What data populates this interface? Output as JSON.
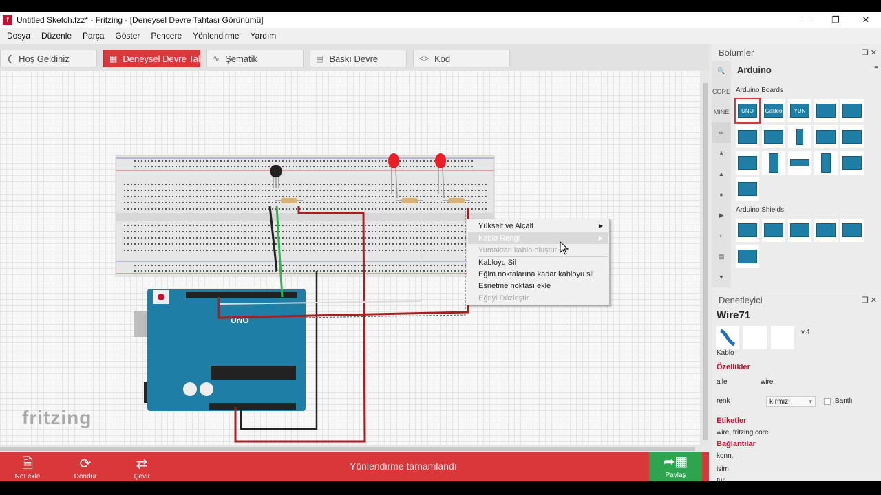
{
  "window": {
    "title": "Untitled Sketch.fzz* - Fritzing - [Deneysel Devre Tahtası Görünümü]",
    "icon_letter": "f"
  },
  "menu": [
    "Dosya",
    "Düzenle",
    "Parça",
    "Göster",
    "Pencere",
    "Yönlendirme",
    "Yardım"
  ],
  "tabs": [
    {
      "label": "Hoş Geldiniz",
      "icon": "back-icon"
    },
    {
      "label": "Deneysel Devre Tahtası",
      "icon": "breadboard-icon"
    },
    {
      "label": "Şematik",
      "icon": "schematic-icon"
    },
    {
      "label": "Baskı Devre",
      "icon": "pcb-icon"
    },
    {
      "label": "Kod",
      "icon": "code-icon"
    }
  ],
  "canvas": {
    "logo": "fritzing"
  },
  "context_menu": {
    "items": [
      {
        "label": "Yükselt ve Alçalt",
        "submenu": true,
        "disabled": false,
        "highlighted": false
      },
      {
        "label": "Kablo Rengi",
        "submenu": true,
        "disabled": false,
        "highlighted": true
      },
      {
        "label": "Yumaktan kablo oluştur",
        "submenu": false,
        "disabled": true,
        "highlighted": false
      },
      {
        "label": "Kabloyu Sil",
        "submenu": false,
        "disabled": false,
        "highlighted": false
      },
      {
        "label": "Eğim noktalarına kadar kabloyu sil",
        "submenu": false,
        "disabled": false,
        "highlighted": false
      },
      {
        "label": "Esnetme noktası ekle",
        "submenu": false,
        "disabled": false,
        "highlighted": false
      },
      {
        "label": "Eğriyi Düzleştir",
        "submenu": false,
        "disabled": true,
        "highlighted": false
      }
    ]
  },
  "bottom_bar": {
    "buttons": [
      {
        "label": "Not ekle",
        "icon": "note-icon"
      },
      {
        "label": "Döndür",
        "icon": "rotate-icon"
      },
      {
        "label": "Çevir",
        "icon": "flip-icon"
      }
    ],
    "status": "Yönlendirme tamamlandı",
    "share_label": "Paylaş"
  },
  "parts_bin": {
    "header": "Bölümler",
    "search_title": "Arduino",
    "side_tabs": [
      "CORE",
      "MINE"
    ],
    "sections": [
      {
        "title": "Arduino Boards",
        "items": [
          "UNO",
          "Galileo",
          "YUN",
          "",
          "",
          "",
          "",
          "",
          "",
          "",
          "",
          "",
          "",
          "",
          "",
          ""
        ]
      },
      {
        "title": "Arduino Shields",
        "items": [
          "",
          "",
          "",
          "",
          "",
          ""
        ]
      }
    ]
  },
  "inspector": {
    "header": "Denetleyici",
    "title": "Wire71",
    "version": "v.4",
    "kind": "Kablo",
    "properties_title": "Özellikler",
    "properties": [
      {
        "key": "aile",
        "value": "wire"
      },
      {
        "key": "renk",
        "value": "kırmızı",
        "checkbox_label": "Bantlı"
      }
    ],
    "tags_title": "Etiketler",
    "tags": "wire, fritzing core",
    "connections_title": "Bağlantılar",
    "connections": [
      {
        "key": "konn."
      },
      {
        "key": "isim"
      },
      {
        "key": "tür"
      }
    ]
  },
  "colors": {
    "accent": "#d9373a",
    "share": "#2ea44f",
    "arduino": "#1f7ea5",
    "wire_red": "#b01c1c",
    "wire_black": "#222222",
    "wire_green": "#2db84a"
  }
}
